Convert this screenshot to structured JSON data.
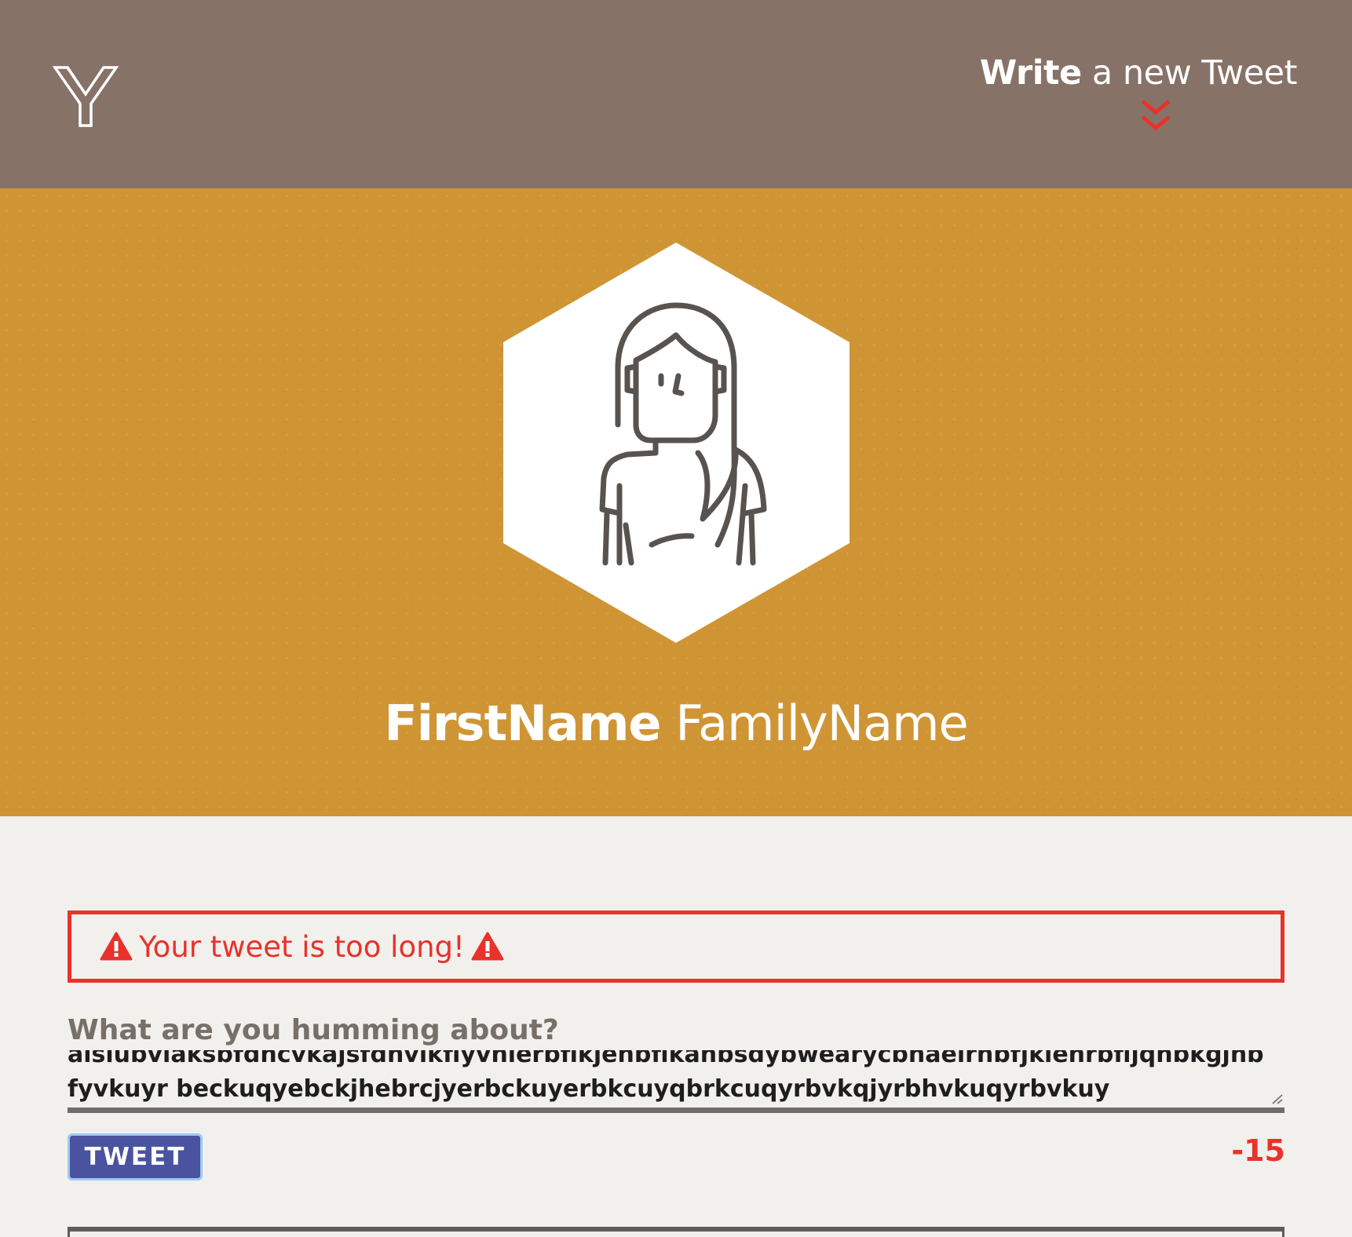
{
  "colors": {
    "nav_bg": "#877268",
    "banner_bg": "#cf9535",
    "page_bg": "#f1f0ec",
    "error_red": "#e8322b",
    "button_bg": "#4a53a0"
  },
  "nav": {
    "logo_icon": "y-logo-icon",
    "title_bold": "Write",
    "title_rest": " a new Tweet",
    "chevron_icon": "double-chevron-down-icon"
  },
  "profile": {
    "avatar_icon": "woman-avatar-icon",
    "first_name": "FirstName",
    "family_name": "FamilyName"
  },
  "compose": {
    "error": {
      "icon": "warning-icon",
      "message": "Your tweet is too long!"
    },
    "label": "What are you humming about?",
    "text": "alsiubvlaksbfdncvkajsfdnvlkflyvnlerbflkjenbflkanbsdybwearycbnaelrnbfjklenrbfljqnbkgjnbfyvkuyr beckuqyebckjhebrcjyerbckuyerbkcuyqbrkcuqyrbvkqjyrbhvkuqyrbvkuy",
    "button_label": "TWEET",
    "remaining": "-15"
  }
}
